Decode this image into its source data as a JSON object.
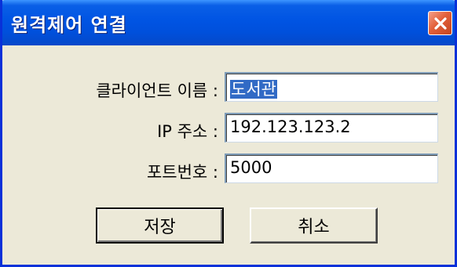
{
  "dialog": {
    "title": "원격제어 연결",
    "close_icon": "close-icon"
  },
  "form": {
    "client_name_label": "클라이언트 이름 :",
    "client_name_value": "도서관",
    "ip_label": "IP 주소 :",
    "ip_value": "192.123.123.2",
    "port_label": "포트번호 :",
    "port_value": "5000"
  },
  "buttons": {
    "save_label": "저장",
    "cancel_label": "취소"
  },
  "colors": {
    "titlebar": "#0054e3",
    "close_button": "#e2603a",
    "dialog_background": "#ece9d8",
    "selection": "#316ac5"
  }
}
